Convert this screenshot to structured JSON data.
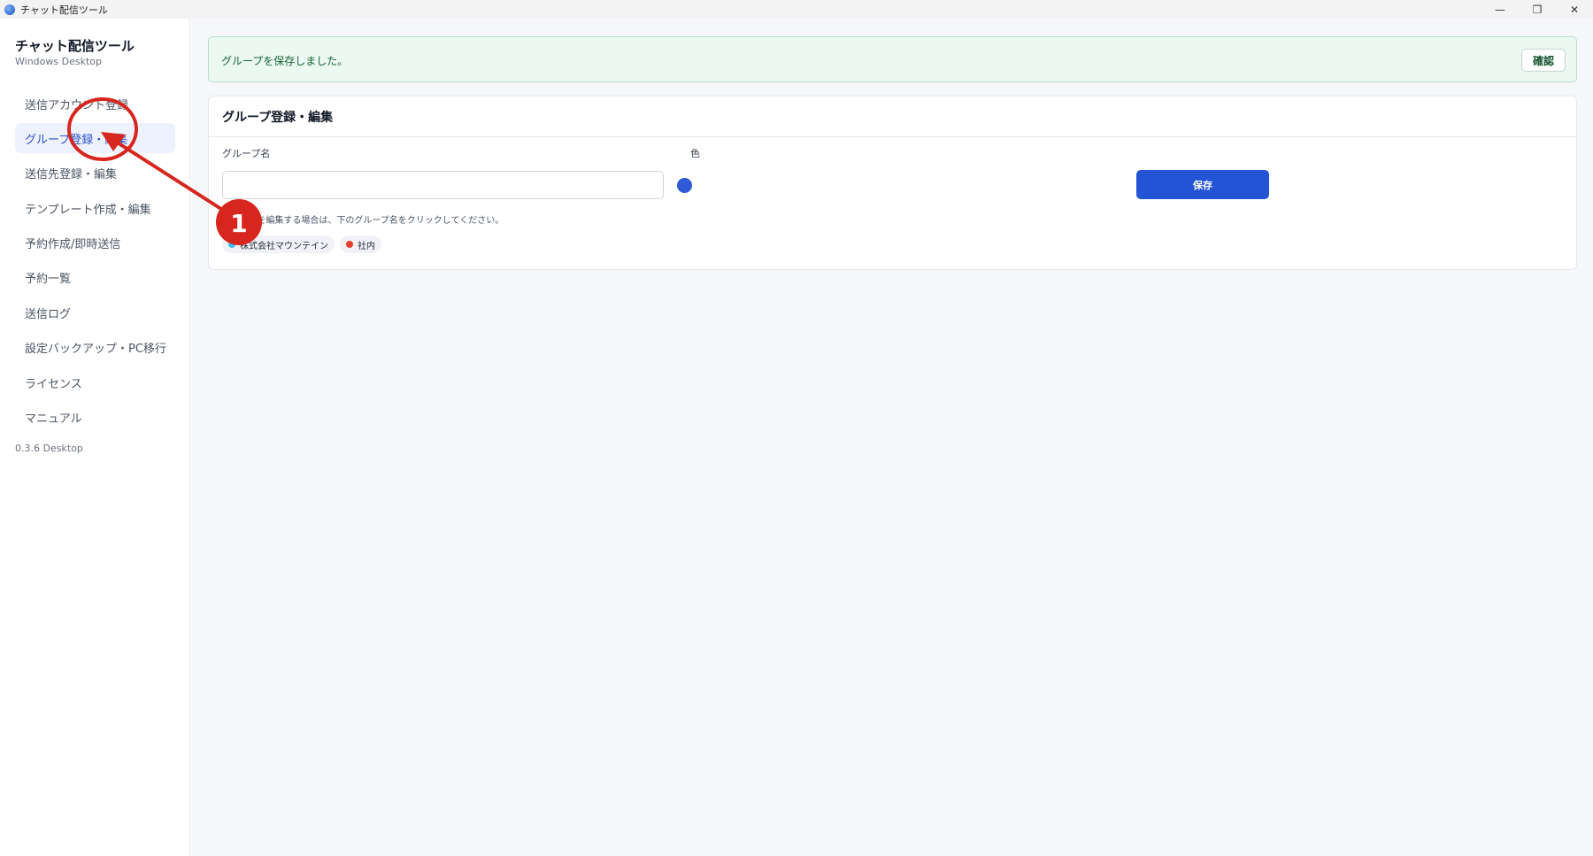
{
  "window": {
    "title": "チャット配信ツール",
    "controls": {
      "minimize": "—",
      "restore": "❐",
      "close": "✕"
    }
  },
  "sidebar": {
    "brand_title": "チャット配信ツール",
    "brand_sub": "Windows Desktop",
    "items": [
      {
        "label": "送信アカウント登録"
      },
      {
        "label": "グループ登録・編集",
        "active": true
      },
      {
        "label": "送信先登録・編集"
      },
      {
        "label": "テンプレート作成・編集"
      },
      {
        "label": "予約作成/即時送信"
      },
      {
        "label": "予約一覧"
      },
      {
        "label": "送信ログ"
      },
      {
        "label": "設定バックアップ・PC移行"
      },
      {
        "label": "ライセンス"
      },
      {
        "label": "マニュアル"
      }
    ],
    "version": "0.3.6 Desktop"
  },
  "alert": {
    "message": "グループを保存しました。",
    "confirm_label": "確認"
  },
  "card": {
    "title": "グループ登録・編集",
    "name_label": "グループ名",
    "name_value": "",
    "color_label": "色",
    "selected_color": "#2f5bd8",
    "save_label": "保存",
    "hint": "グループを編集する場合は、下のグループ名をクリックしてください。",
    "groups": [
      {
        "name": "株式会社マウンテイン",
        "color": "#38bdf8"
      },
      {
        "name": "社内",
        "color": "#e53e2e"
      }
    ]
  },
  "annotation": {
    "step_number": "1",
    "color": "#d7261e"
  }
}
